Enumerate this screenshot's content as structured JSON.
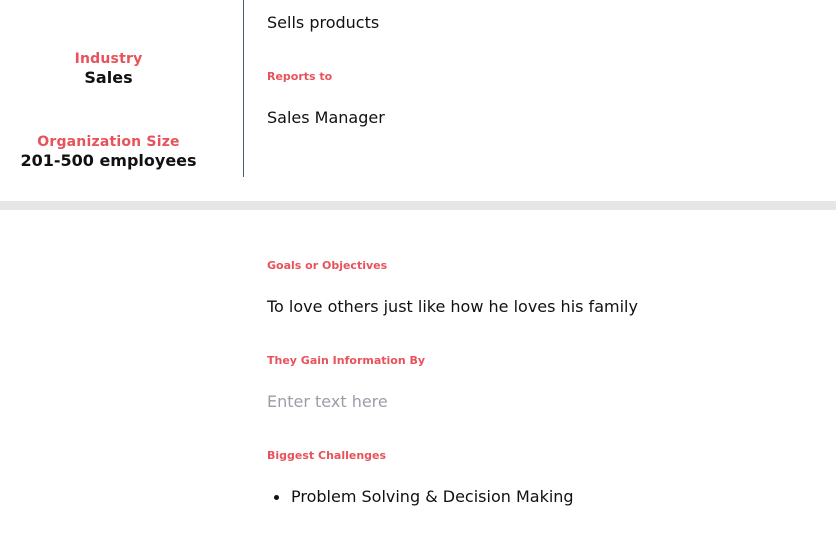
{
  "profile": {
    "industry_label": "Industry",
    "industry_value": "Sales",
    "org_size_label": "Organization Size",
    "org_size_value": "201-500 employees"
  },
  "role": {
    "description": "Sells products",
    "reports_to_label": "Reports to",
    "reports_to_value": "Sales Manager"
  },
  "details": {
    "goals_label": "Goals or Objectives",
    "goals_value": "To love others just like how he loves his family",
    "info_label": "They Gain Information By",
    "info_placeholder": "Enter text here",
    "challenges_label": "Biggest Challenges",
    "challenges_items": [
      "Problem Solving & Decision Making"
    ]
  },
  "colors": {
    "accent": "#e8525a",
    "divider": "#e6e6e6",
    "column_rule": "#4a5a6a",
    "placeholder": "#9a9ea8"
  }
}
